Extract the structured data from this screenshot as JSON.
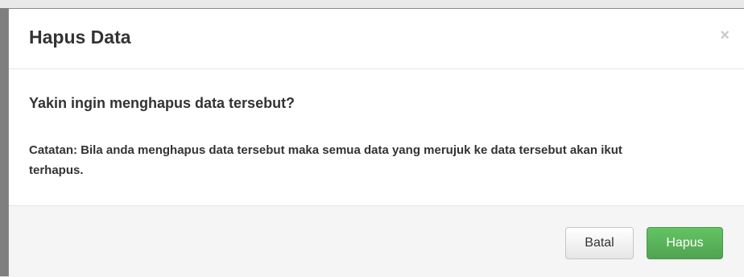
{
  "modal": {
    "title": "Hapus Data",
    "close_symbol": "×",
    "question": "Yakin ingin menghapus data tersebut?",
    "note": "Catatan: Bila anda menghapus data tersebut maka semua data yang merujuk ke data tersebut akan ikut terhapus.",
    "buttons": {
      "cancel_label": "Batal",
      "delete_label": "Hapus"
    }
  },
  "colors": {
    "delete_button": "#5cb85c",
    "footer_background": "#f5f5f5"
  }
}
